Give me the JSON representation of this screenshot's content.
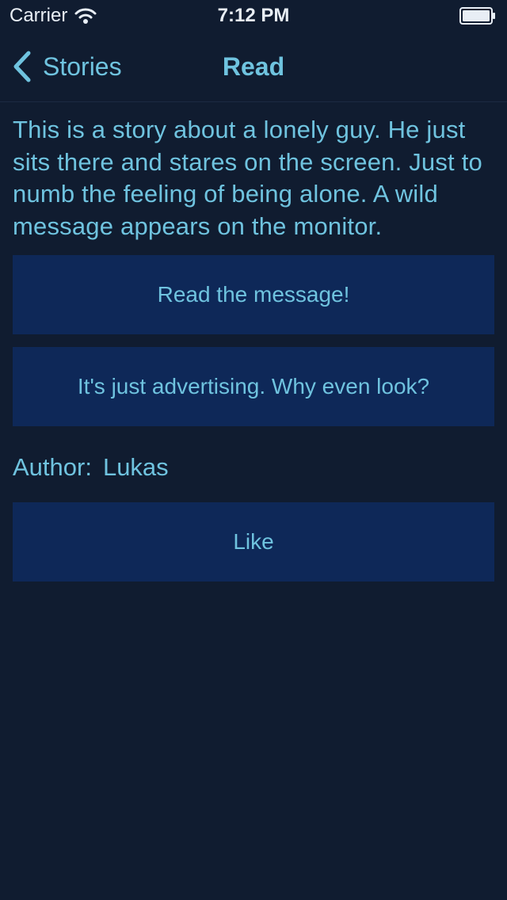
{
  "status_bar": {
    "carrier": "Carrier",
    "time": "7:12 PM",
    "icons": [
      "wifi-icon",
      "battery-icon"
    ]
  },
  "nav": {
    "back_label": "Stories",
    "title": "Read",
    "back_icon": "chevron-left-icon"
  },
  "story": {
    "text": "This is a story about a lonely guy. He just sits there and stares on the screen. Just to numb the feeling of being alone. A wild message appears on the monitor."
  },
  "choices": [
    {
      "label": "Read the message!"
    },
    {
      "label": "It's just advertising. Why even look?"
    }
  ],
  "author": {
    "label": "Author:",
    "name": "Lukas"
  },
  "like_button": {
    "label": "Like"
  },
  "colors": {
    "background": "#101c30",
    "accent_text": "#6fc3df",
    "button_background": "#0e2858",
    "status_text": "#e8eef5"
  }
}
